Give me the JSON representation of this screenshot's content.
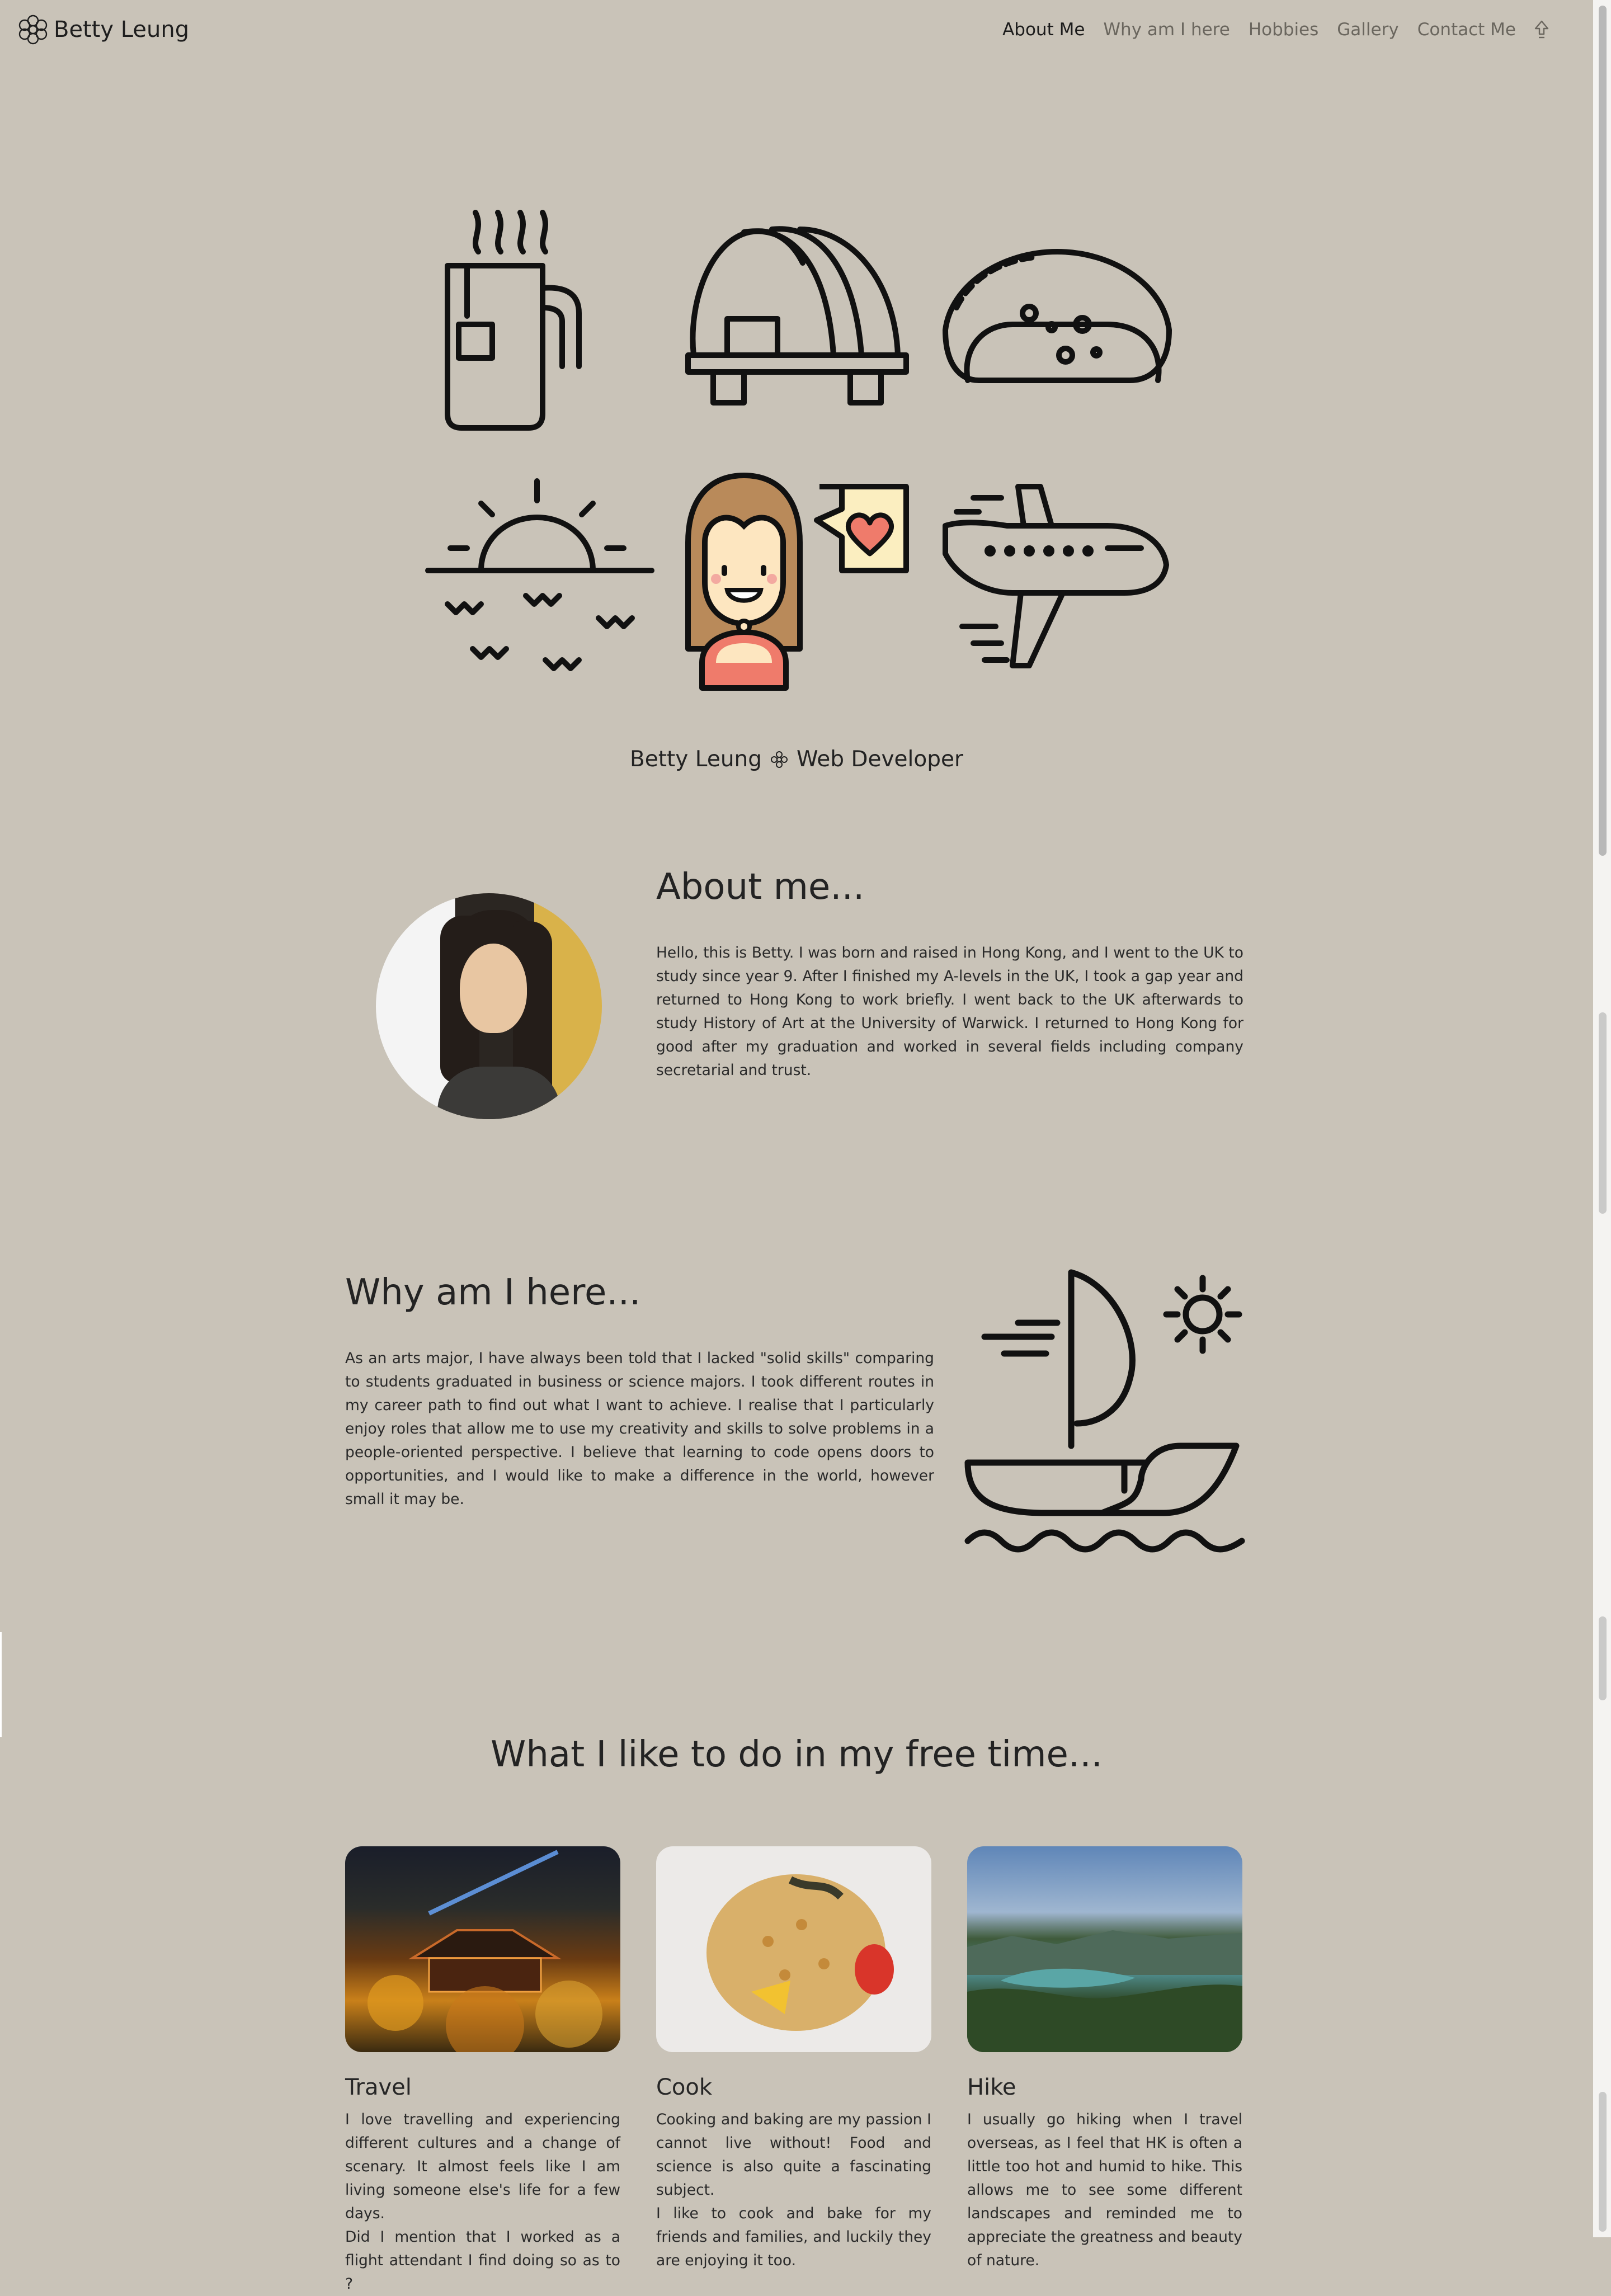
{
  "nav": {
    "brand": "Betty Leung",
    "links": [
      "About Me",
      "Why am I here",
      "Hobbies",
      "Gallery",
      "Contact Me"
    ],
    "active_index": 0
  },
  "hero": {
    "icons": [
      "tea-mug-icon",
      "sushi-icon",
      "taco-icon",
      "sunset-icon",
      "girl-with-heart-icon",
      "airplane-icon"
    ],
    "name": "Betty Leung",
    "role": "Web Developer"
  },
  "about": {
    "title": "About me...",
    "text": "Hello, this is Betty. I was born and raised in Hong Kong, and I went to the UK to study since year 9. After I finished my A-levels in the UK, I took a gap year and returned to Hong Kong to work briefly. I went back to the UK afterwards to study History of Art at the University of Warwick. I returned to Hong Kong for good after my graduation and worked in several fields including company secretarial and trust."
  },
  "why": {
    "title": "Why am I here...",
    "text": "As an arts major, I have always been told that I lacked \"solid skills\" comparing to students graduated in business or science majors. I took different routes in my career path to find out what I want to achieve. I realise that I particularly enjoy roles that allow me to use my creativity and skills to solve problems in a people-oriented perspective. I believe that learning to code opens doors to opportunities, and I would like to make a difference in the world, however small it may be."
  },
  "hobbies": {
    "title": "What I like to do in my free time...",
    "cards": [
      {
        "title": "Travel",
        "text": "I love travelling and experiencing different cultures and a change of scenary. It almost feels like I am living someone else's life for a few days.",
        "text2": "Did I mention that I worked as a flight attendant I find doing so as to ?"
      },
      {
        "title": "Cook",
        "text": "Cooking and baking are my passion I cannot live without! Food and science is also quite a fascinating subject.",
        "text2": "I like to cook and bake for my friends and families, and luckily they are enjoying it too."
      },
      {
        "title": "Hike",
        "text": "I usually go hiking when I travel overseas, as I feel that HK is often a little too hot and humid to hike. This allows me to see some different landscapes and reminded me to appreciate the greatness and beauty of nature.",
        "text2": ""
      }
    ]
  },
  "colors": {
    "background": "#c9c3b8",
    "text": "#1d1d1d",
    "nav_inactive": "#6a665e",
    "accent_heart": "#ef7b6b",
    "accent_hair": "#b98a5a"
  }
}
